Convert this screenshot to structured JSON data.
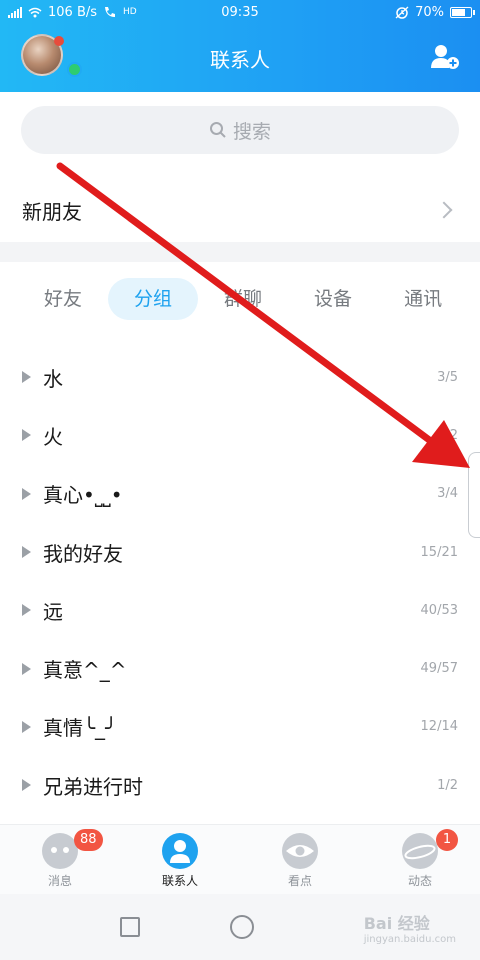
{
  "status_bar": {
    "network_speed": "106 B/s",
    "hd_label": "HD",
    "time": "09:35",
    "battery_percent": "70%",
    "battery_level": 0.7
  },
  "header": {
    "title": "联系人"
  },
  "search": {
    "placeholder": "搜索"
  },
  "new_friends": {
    "label": "新朋友"
  },
  "tabs": [
    {
      "label": "好友",
      "active": false
    },
    {
      "label": "分组",
      "active": true
    },
    {
      "label": "群聊",
      "active": false
    },
    {
      "label": "设备",
      "active": false
    },
    {
      "label": "通讯",
      "active": false
    }
  ],
  "groups": [
    {
      "name": "水",
      "count": "3/5"
    },
    {
      "name": "火",
      "count": "2"
    },
    {
      "name": "真心•⎵⎵•",
      "count": "3/4"
    },
    {
      "name": "我的好友",
      "count": "15/21"
    },
    {
      "name": "远",
      "count": "40/53"
    },
    {
      "name": "真意^_^",
      "count": "49/57"
    },
    {
      "name": "真情╰_╯",
      "count": "12/14"
    },
    {
      "name": "兄弟进行时",
      "count": "1/2"
    }
  ],
  "bottom_nav": [
    {
      "label": "消息",
      "badge": "88",
      "icon": "message-icon",
      "active": false
    },
    {
      "label": "联系人",
      "badge": "",
      "icon": "contacts-icon",
      "active": true
    },
    {
      "label": "看点",
      "badge": "",
      "icon": "eye-icon",
      "active": false
    },
    {
      "label": "动态",
      "badge": "1",
      "icon": "planet-icon",
      "active": false
    }
  ],
  "watermark": {
    "text": "Bai 经验",
    "sub": "jingyan.baidu.com"
  },
  "colors": {
    "header_gradient_start": "#22b8f5",
    "header_gradient_end": "#1b8ff2",
    "accent": "#1ea2ef",
    "badge": "#f25542",
    "annotation_arrow": "#e01c1c"
  }
}
